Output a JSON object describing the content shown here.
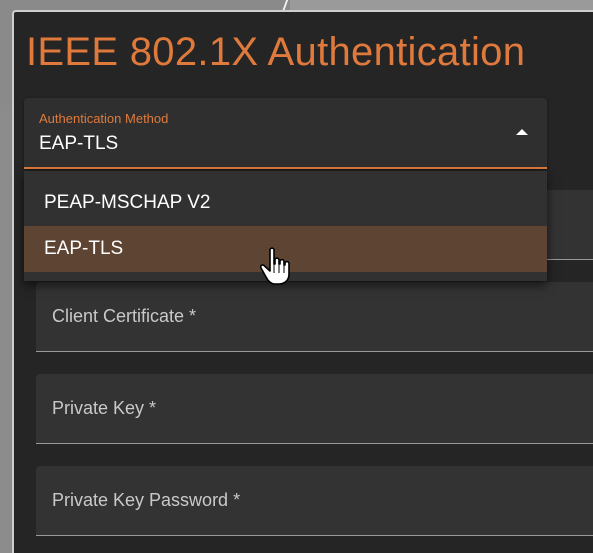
{
  "panel": {
    "title": "IEEE 802.1X Authentication"
  },
  "auth_method": {
    "label": "Authentication Method",
    "value": "EAP-TLS",
    "options": [
      {
        "label": "PEAP-MSCHAP V2",
        "highlighted": false
      },
      {
        "label": "EAP-TLS",
        "highlighted": true
      }
    ]
  },
  "fields": [
    {
      "label": ""
    },
    {
      "label": "Client Certificate *"
    },
    {
      "label": "Private Key *"
    },
    {
      "label": "Private Key Password *"
    }
  ],
  "colors": {
    "accent": "#e07a3c",
    "panel_bg": "#252525",
    "highlight": "#5e4433"
  },
  "icons": {
    "select_caret": "caret-up-icon",
    "pointer": "hand-cursor-icon"
  }
}
